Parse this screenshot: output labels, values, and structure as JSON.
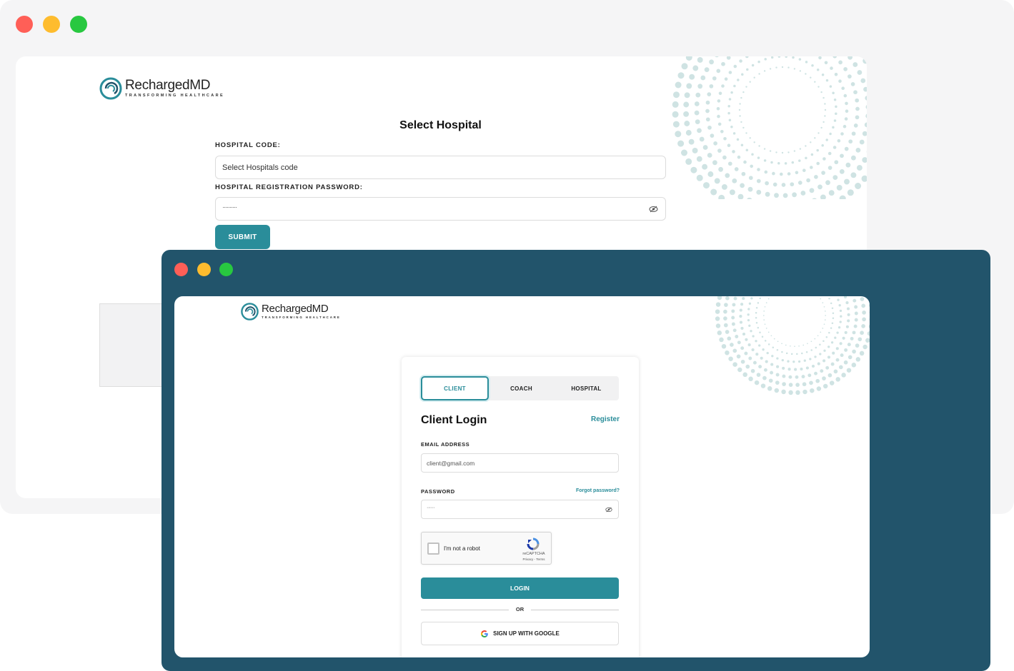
{
  "colors": {
    "teal": "#2a8d9a",
    "navy": "#22546b",
    "dot_red": "#ff5f57",
    "dot_yellow": "#febc2e",
    "dot_green": "#28c840"
  },
  "back_window": {
    "logo": {
      "brand": "RechargedMD",
      "tagline": "TRANSFORMING HEALTHCARE"
    },
    "title": "Select Hospital",
    "hospital_code": {
      "label": "HOSPITAL CODE:",
      "placeholder": "Select Hospitals code"
    },
    "password": {
      "label": "HOSPITAL REGISTRATION PASSWORD:",
      "value": "··········",
      "icon": "eye-off-icon"
    },
    "submit_label": "SUBMIT"
  },
  "front_window": {
    "logo": {
      "brand": "RechargedMD",
      "tagline": "TRANSFORMING HEALTHCARE"
    },
    "tabs": [
      {
        "label": "CLIENT",
        "active": true
      },
      {
        "label": "COACH",
        "active": false
      },
      {
        "label": "HOSPITAL",
        "active": false
      }
    ],
    "heading": "Client Login",
    "register_link": "Register",
    "email": {
      "label": "EMAIL ADDRESS",
      "placeholder": "client@gmail.com"
    },
    "password": {
      "label": "PASSWORD",
      "forgot": "Forgot password?",
      "value": "······",
      "icon": "eye-off-icon"
    },
    "captcha": {
      "label": "I'm not a robot",
      "brand": "reCAPTCHA",
      "links": "Privacy - Terms"
    },
    "login_label": "LOGIN",
    "or_label": "OR",
    "google_label": "SIGN UP WITH GOOGLE"
  }
}
